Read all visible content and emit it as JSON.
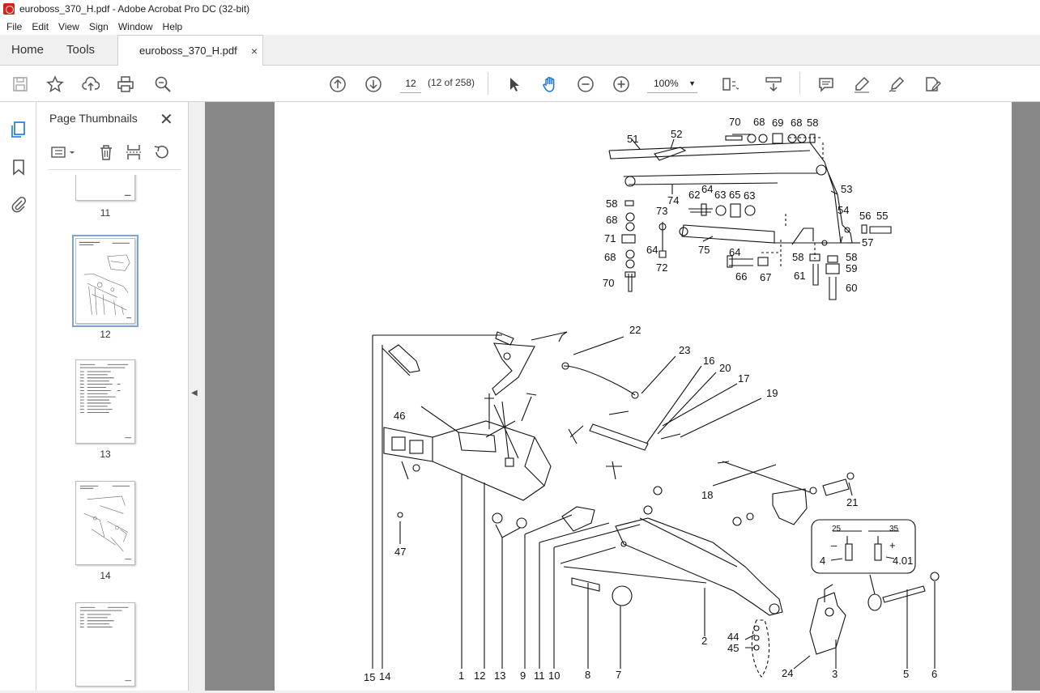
{
  "window": {
    "title": "euroboss_370_H.pdf - Adobe Acrobat Pro DC (32-bit)"
  },
  "menu": [
    "File",
    "Edit",
    "View",
    "Sign",
    "Window",
    "Help"
  ],
  "tabs": {
    "home": "Home",
    "tools": "Tools",
    "document": "euroboss_370_H.pdf",
    "close": "×"
  },
  "toolbar": {
    "page_number": "12",
    "page_count": "(12 of 258)",
    "zoom": "100%"
  },
  "panel": {
    "title": "Page Thumbnails",
    "close": "✕",
    "thumbnails": [
      {
        "label": "11"
      },
      {
        "label": "12",
        "selected": true
      },
      {
        "label": "13"
      },
      {
        "label": "14"
      },
      {
        "label": ""
      }
    ]
  },
  "drawing": {
    "top_labels": [
      "70",
      "68",
      "69",
      "68",
      "58",
      "51",
      "52",
      "53",
      "74",
      "62",
      "64",
      "63",
      "65",
      "63",
      "58",
      "68",
      "73",
      "71",
      "64",
      "72",
      "75",
      "54",
      "56",
      "55",
      "57",
      "68",
      "70",
      "64",
      "66",
      "67",
      "58",
      "58",
      "59",
      "61",
      "60"
    ],
    "main_labels": [
      "22",
      "23",
      "16",
      "20",
      "17",
      "19",
      "46",
      "18",
      "21",
      "47",
      "25",
      "35",
      "4",
      "4.01",
      "44",
      "45",
      "2",
      "15",
      "14",
      "1",
      "12",
      "13",
      "9",
      "11",
      "10",
      "8",
      "7",
      "24",
      "3",
      "5",
      "6"
    ],
    "inset_marks": {
      "minus": "–",
      "plus": "+"
    }
  }
}
